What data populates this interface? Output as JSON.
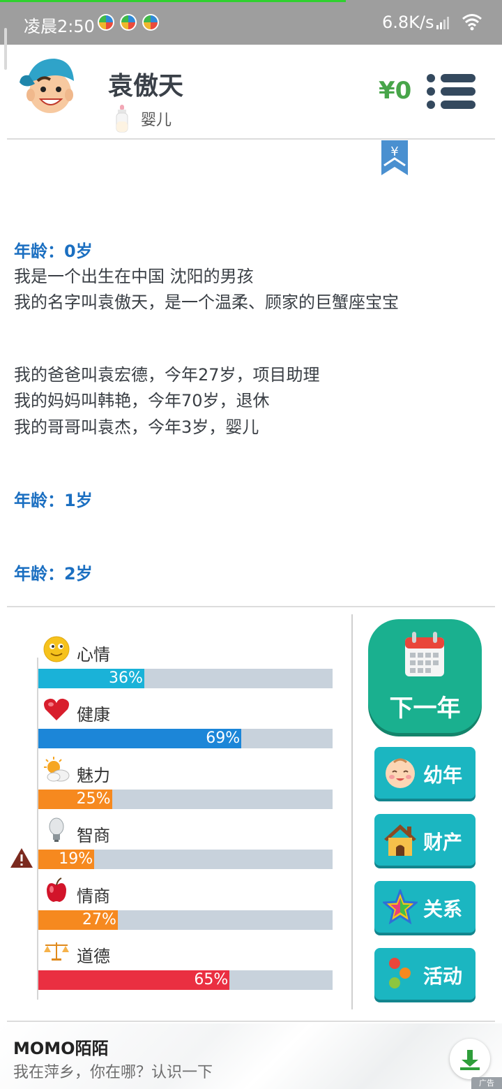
{
  "status_bar": {
    "time": "凌晨2:50",
    "net_speed": "6.8K/s",
    "page_load_progress": 0.69,
    "icons": [
      "app-notification-icon",
      "app-notification-icon",
      "app-notification-icon",
      "signal-icon",
      "wifi-icon"
    ]
  },
  "header": {
    "name": "袁傲天",
    "stage": "婴儿",
    "money": "¥0",
    "bookmark_symbol": "¥",
    "icons": [
      "avatar-boy",
      "baby-bottle-icon",
      "menu-icon",
      "yen-bookmark-icon"
    ]
  },
  "log": {
    "entries": [
      {
        "type": "age",
        "text": "年龄：0岁"
      },
      {
        "type": "line",
        "text": "我是一个出生在中国 沈阳的男孩"
      },
      {
        "type": "line",
        "text": "我的名字叫袁傲天，是一个温柔、顾家的巨蟹座宝宝"
      },
      {
        "type": "line",
        "text": "我的爸爸叫袁宏德，今年27岁，项目助理"
      },
      {
        "type": "line",
        "text": "我的妈妈叫韩艳，今年70岁，退休"
      },
      {
        "type": "line",
        "text": "我的哥哥叫袁杰，今年3岁，婴儿"
      },
      {
        "type": "age",
        "text": "年龄：1岁"
      },
      {
        "type": "age",
        "text": "年龄：2岁"
      }
    ]
  },
  "stats": [
    {
      "label": "心情",
      "pct_label": "36%",
      "value": 0.36,
      "color": "#1ab2d8",
      "icon": "smiley-icon"
    },
    {
      "label": "健康",
      "pct_label": "69%",
      "value": 0.69,
      "color": "#1c86d8",
      "icon": "heart-icon"
    },
    {
      "label": "魅力",
      "pct_label": "25%",
      "value": 0.25,
      "color": "#f6891f",
      "icon": "sun-cloud-icon"
    },
    {
      "label": "智商",
      "pct_label": "19%",
      "value": 0.19,
      "color": "#f6891f",
      "icon": "lightbulb-icon"
    },
    {
      "label": "情商",
      "pct_label": "27%",
      "value": 0.27,
      "color": "#f6891f",
      "icon": "apple-icon"
    },
    {
      "label": "道德",
      "pct_label": "65%",
      "value": 0.65,
      "color": "#ea2f41",
      "icon": "scales-icon"
    }
  ],
  "warning_icon": "warning-icon",
  "actions": {
    "next_year": {
      "label": "下一年",
      "icon": "calendar-icon"
    },
    "buttons": [
      {
        "label": "幼年",
        "icon": "baby-face-icon"
      },
      {
        "label": "财产",
        "icon": "house-icon"
      },
      {
        "label": "关系",
        "icon": "star-icon"
      },
      {
        "label": "活动",
        "icon": "activity-dots-icon"
      }
    ]
  },
  "ad": {
    "title": "MOMO陌陌",
    "subtitle": "我在萍乡，你在哪？认识一下",
    "badge": "广告",
    "icon": "download-icon"
  },
  "colors": {
    "status_bar_bg": "#9e9e9e",
    "progress": "#2fd12f",
    "money": "#48a54a",
    "age_text": "#1b6fc1",
    "track": "#c8d2dc",
    "next_button": "#1ab08f",
    "side_button": "#1bb6c1",
    "menu_icon": "#34495e"
  }
}
